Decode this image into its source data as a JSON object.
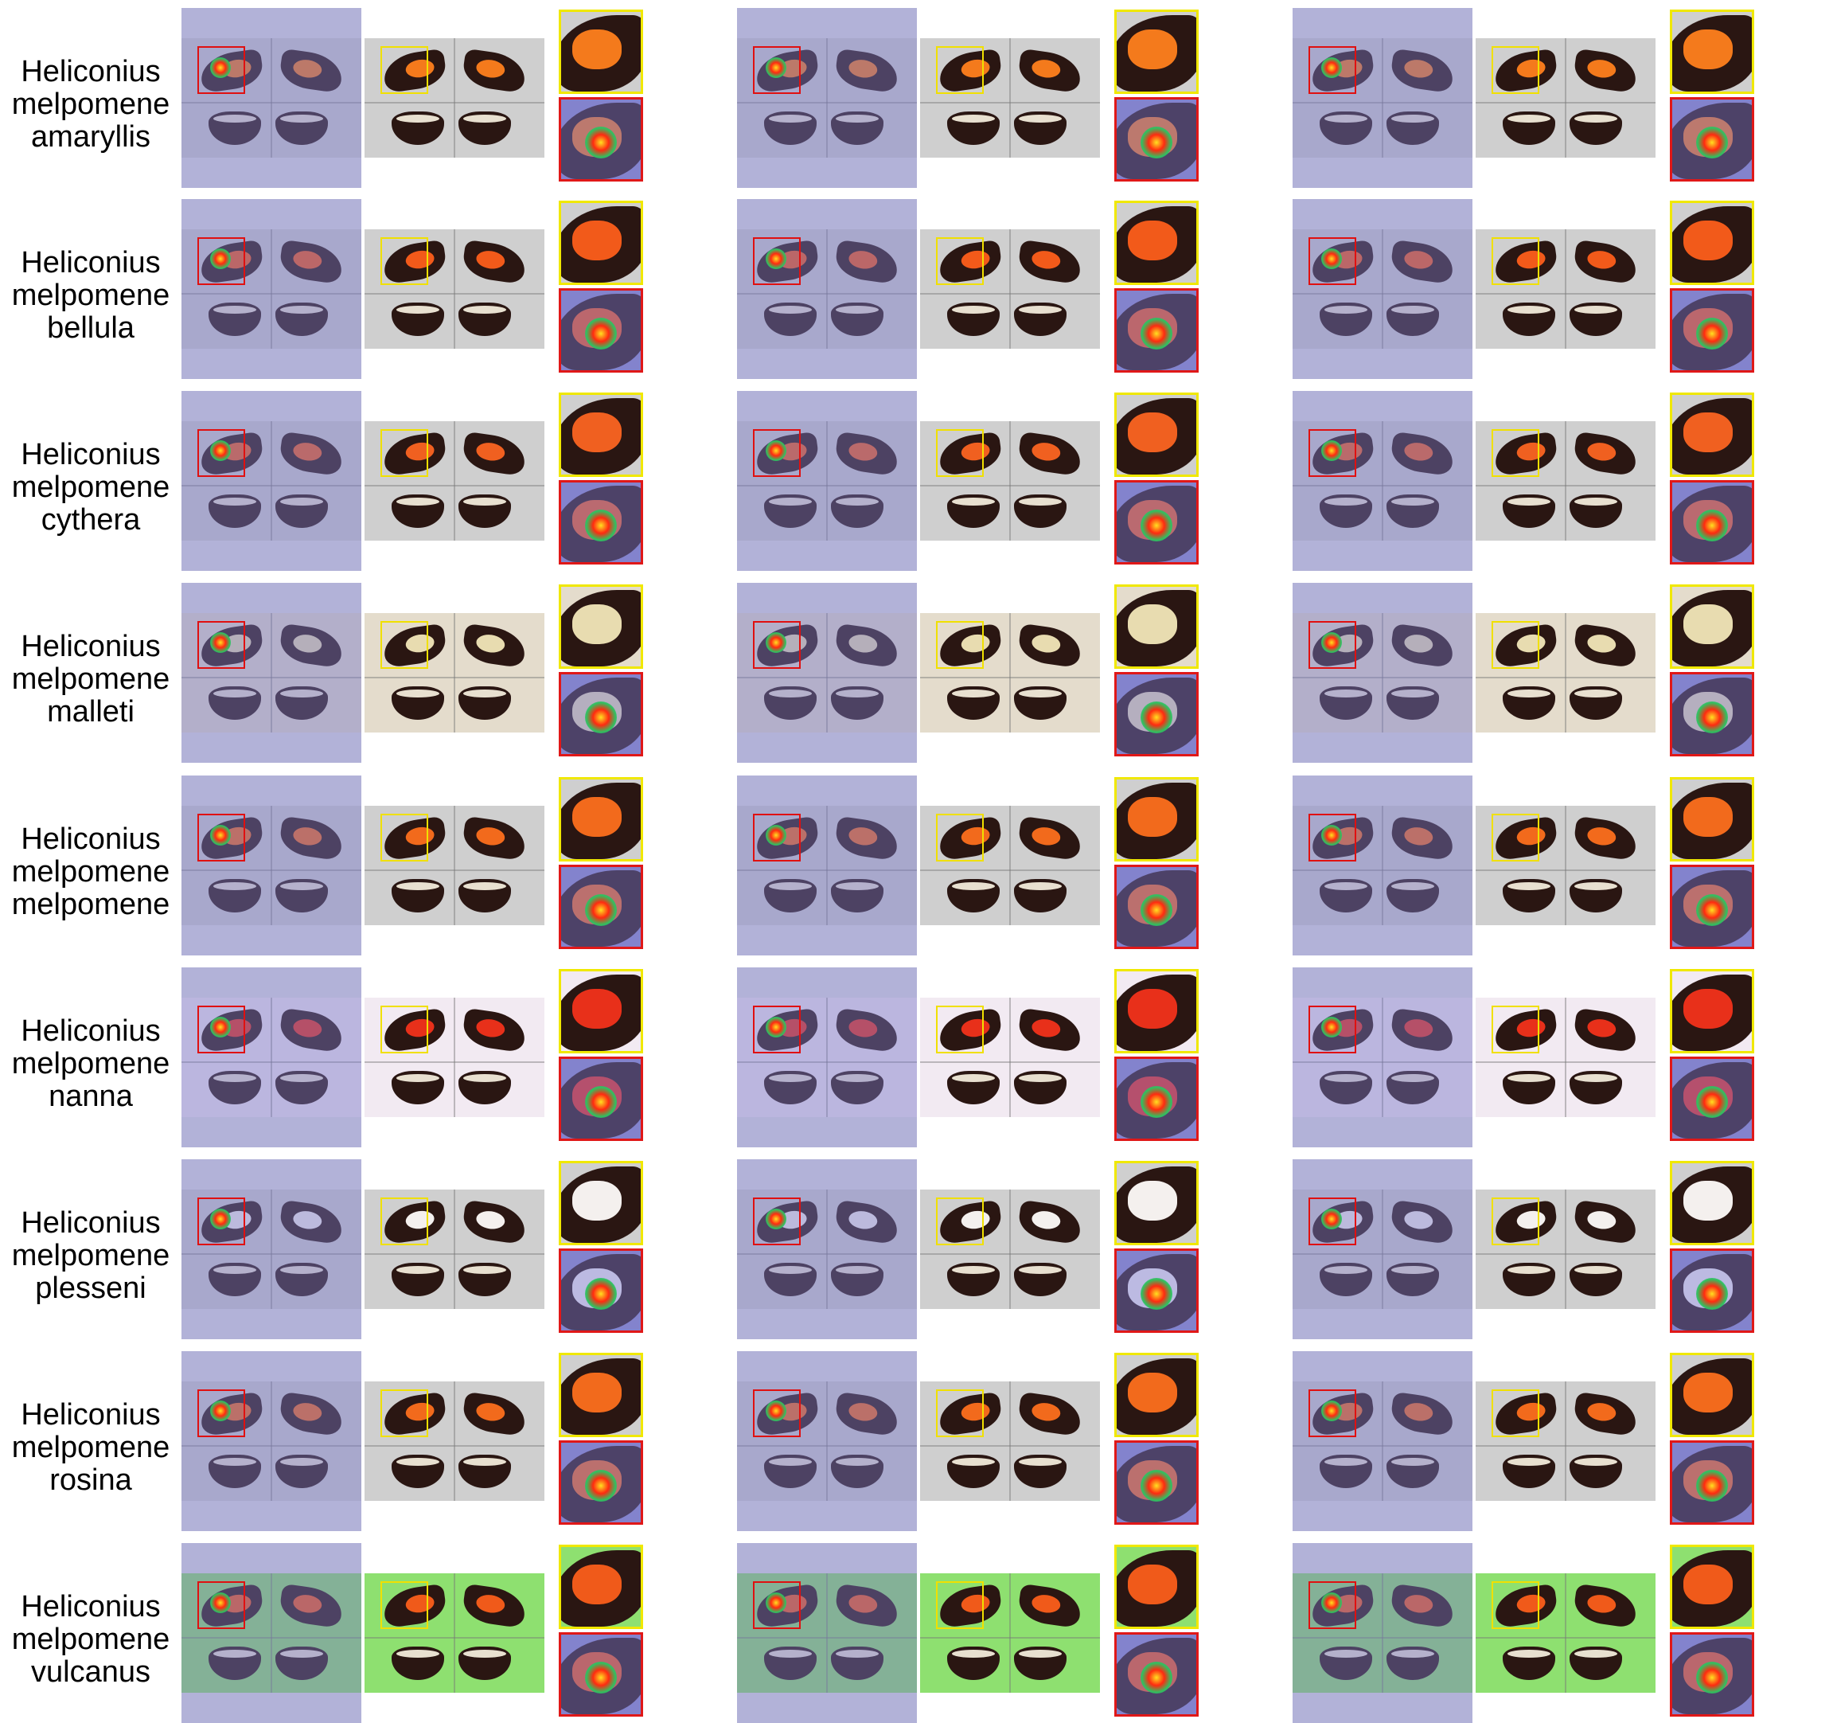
{
  "rows": [
    {
      "label": [
        "Heliconius",
        "melpomene",
        "amaryllis"
      ],
      "band": "#f47a1c",
      "bg": "#cfcfcf"
    },
    {
      "label": [
        "Heliconius",
        "melpomene",
        "bellula"
      ],
      "band": "#f25a1a",
      "bg": "#cfcfcf"
    },
    {
      "label": [
        "Heliconius",
        "melpomene",
        "cythera"
      ],
      "band": "#f06020",
      "bg": "#cfcfcf"
    },
    {
      "label": [
        "Heliconius",
        "melpomene",
        "malleti"
      ],
      "band": "#e8dcb0",
      "bg": "#e4dccc"
    },
    {
      "label": [
        "Heliconius",
        "melpomene",
        "melpomene"
      ],
      "band": "#f26a1c",
      "bg": "#cfcfcf"
    },
    {
      "label": [
        "Heliconius",
        "melpomene",
        "nanna"
      ],
      "band": "#e8301a",
      "bg": "#f2eaf2"
    },
    {
      "label": [
        "Heliconius",
        "melpomene",
        "plesseni"
      ],
      "band": "#f4f0ee",
      "bg": "#cfcfcf"
    },
    {
      "label": [
        "Heliconius",
        "melpomene",
        "rosina"
      ],
      "band": "#f26a1c",
      "bg": "#cfcfcf"
    },
    {
      "label": [
        "Heliconius",
        "melpomene",
        "vulcanus"
      ],
      "band": "#f05a1a",
      "bg": "#8ee070"
    }
  ]
}
